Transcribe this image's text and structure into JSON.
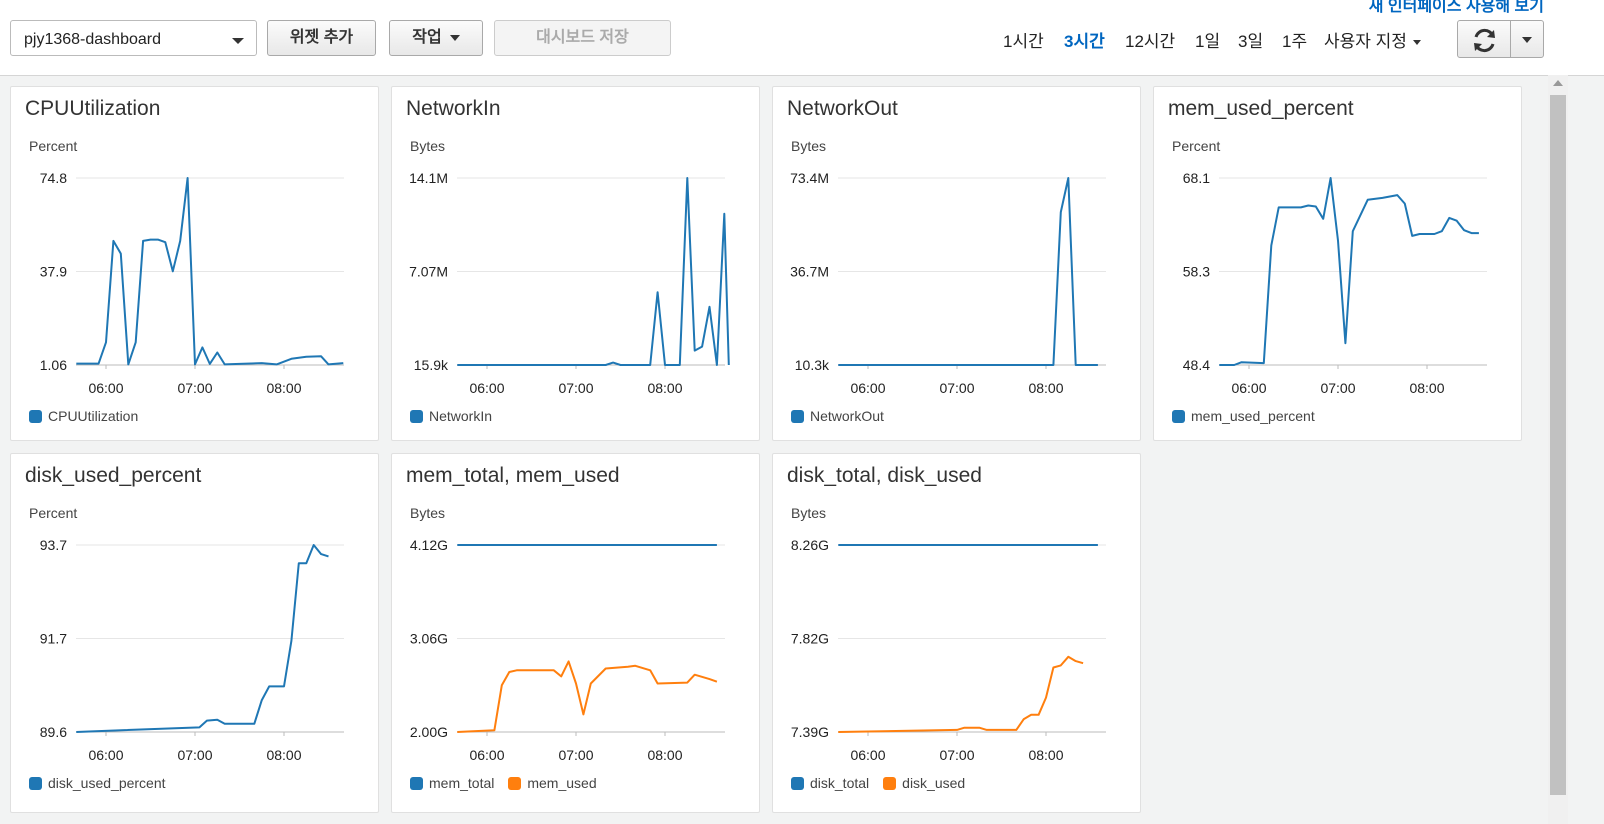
{
  "toolbar": {
    "dashboard_select": "pjy1368-dashboard",
    "add_widget": "위젯 추가",
    "actions": "작업",
    "save_dashboard": "대시보드 저장",
    "top_link": "새 인터페이스 사용해 보기",
    "time_ranges": [
      {
        "label": "1시간",
        "active": false
      },
      {
        "label": "3시간",
        "active": true
      },
      {
        "label": "12시간",
        "active": false
      },
      {
        "label": "1일",
        "active": false
      },
      {
        "label": "3일",
        "active": false
      },
      {
        "label": "1주",
        "active": false
      }
    ],
    "custom_range": "사용자 지정",
    "refresh_icon": "refresh-icon"
  },
  "colors": {
    "series1": "#1f77b4",
    "series2": "#ff7f0e",
    "accent": "#0066c0"
  },
  "chart_data": [
    {
      "type": "line",
      "title": "CPUUtilization",
      "ylabel": "Percent",
      "yticks": [
        "74.8",
        "37.9",
        "1.06"
      ],
      "ylim": [
        1.06,
        74.8
      ],
      "xticks": [
        "06:00",
        "07:00",
        "08:00"
      ],
      "series": [
        {
          "name": "CPUUtilization",
          "color": "#1f77b4",
          "points": [
            [
              -20,
              1.6
            ],
            [
              -5,
              1.6
            ],
            [
              0,
              10
            ],
            [
              5,
              50
            ],
            [
              10,
              45
            ],
            [
              15,
              1.3
            ],
            [
              20,
              10
            ],
            [
              25,
              50
            ],
            [
              30,
              50.5
            ],
            [
              35,
              50.5
            ],
            [
              40,
              49.5
            ],
            [
              45,
              38
            ],
            [
              50,
              50
            ],
            [
              55,
              74.8
            ],
            [
              60,
              1.3
            ],
            [
              65,
              8
            ],
            [
              70,
              1.5
            ],
            [
              75,
              6
            ],
            [
              80,
              1.3
            ],
            [
              90,
              1.5
            ],
            [
              105,
              1.8
            ],
            [
              115,
              1.3
            ],
            [
              125,
              3.5
            ],
            [
              135,
              4.3
            ],
            [
              145,
              4.5
            ],
            [
              150,
              1.3
            ],
            [
              160,
              1.8
            ]
          ]
        }
      ]
    },
    {
      "type": "line",
      "title": "NetworkIn",
      "ylabel": "Bytes",
      "yticks": [
        "14.1M",
        "7.07M",
        "15.9k"
      ],
      "ylim": [
        0.0159,
        14.1
      ],
      "yunit": "M",
      "xticks": [
        "06:00",
        "07:00",
        "08:00"
      ],
      "series": [
        {
          "name": "NetworkIn",
          "color": "#1f77b4",
          "points": [
            [
              -20,
              0.0159
            ],
            [
              80,
              0.0159
            ],
            [
              85,
              0.2
            ],
            [
              90,
              0.0159
            ],
            [
              95,
              0.0159
            ],
            [
              105,
              0.0159
            ],
            [
              110,
              0.0159
            ],
            [
              115,
              5.5
            ],
            [
              120,
              0.0159
            ],
            [
              130,
              0.0159
            ],
            [
              135,
              14.1
            ],
            [
              140,
              1.1
            ],
            [
              145,
              1.4
            ],
            [
              150,
              4.4
            ],
            [
              155,
              0.0159
            ],
            [
              160,
              11.4
            ],
            [
              163,
              0.0159
            ]
          ]
        }
      ]
    },
    {
      "type": "line",
      "title": "NetworkOut",
      "ylabel": "Bytes",
      "yticks": [
        "73.4M",
        "36.7M",
        "10.3k"
      ],
      "ylim": [
        0.0103,
        73.4
      ],
      "yunit": "M",
      "xticks": [
        "06:00",
        "07:00",
        "08:00"
      ],
      "series": [
        {
          "name": "NetworkOut",
          "color": "#1f77b4",
          "points": [
            [
              -20,
              0.0103
            ],
            [
              125,
              0.0103
            ],
            [
              130,
              60
            ],
            [
              135,
              73.4
            ],
            [
              140,
              0.0103
            ],
            [
              155,
              0.0103
            ]
          ]
        }
      ]
    },
    {
      "type": "line",
      "title": "mem_used_percent",
      "ylabel": "Percent",
      "yticks": [
        "68.1",
        "58.3",
        "48.4"
      ],
      "ylim": [
        48.4,
        68.1
      ],
      "xticks": [
        "06:00",
        "07:00",
        "08:00"
      ],
      "series": [
        {
          "name": "mem_used_percent",
          "color": "#1f77b4",
          "points": [
            [
              -20,
              48.4
            ],
            [
              -10,
              48.4
            ],
            [
              -5,
              48.7
            ],
            [
              10,
              48.6
            ],
            [
              15,
              61
            ],
            [
              20,
              65
            ],
            [
              35,
              65
            ],
            [
              40,
              65.2
            ],
            [
              45,
              65.1
            ],
            [
              50,
              63.8
            ],
            [
              55,
              68.1
            ],
            [
              60,
              61.5
            ],
            [
              65,
              50.7
            ],
            [
              70,
              62.5
            ],
            [
              80,
              65.8
            ],
            [
              90,
              66
            ],
            [
              100,
              66.3
            ],
            [
              105,
              65.4
            ],
            [
              110,
              62
            ],
            [
              115,
              62.2
            ],
            [
              125,
              62.2
            ],
            [
              130,
              62.5
            ],
            [
              135,
              63.9
            ],
            [
              140,
              63.6
            ],
            [
              145,
              62.6
            ],
            [
              150,
              62.3
            ],
            [
              155,
              62.3
            ]
          ]
        }
      ]
    },
    {
      "type": "line",
      "title": "disk_used_percent",
      "ylabel": "Percent",
      "yticks": [
        "93.7",
        "91.7",
        "89.6"
      ],
      "ylim": [
        89.6,
        93.7
      ],
      "xticks": [
        "06:00",
        "07:00",
        "08:00"
      ],
      "series": [
        {
          "name": "disk_used_percent",
          "color": "#1f77b4",
          "points": [
            [
              -20,
              89.6
            ],
            [
              -5,
              89.62
            ],
            [
              63,
              89.7
            ],
            [
              68,
              89.85
            ],
            [
              75,
              89.87
            ],
            [
              80,
              89.78
            ],
            [
              100,
              89.78
            ],
            [
              105,
              90.3
            ],
            [
              110,
              90.6
            ],
            [
              120,
              90.6
            ],
            [
              125,
              91.6
            ],
            [
              130,
              93.3
            ],
            [
              135,
              93.3
            ],
            [
              140,
              93.7
            ],
            [
              145,
              93.5
            ],
            [
              150,
              93.45
            ]
          ]
        }
      ]
    },
    {
      "type": "line",
      "title": "mem_total, mem_used",
      "ylabel": "Bytes",
      "yticks": [
        "4.12G",
        "3.06G",
        "2.00G"
      ],
      "ylim": [
        2.0,
        4.12
      ],
      "yunit": "G",
      "xticks": [
        "06:00",
        "07:00",
        "08:00"
      ],
      "series": [
        {
          "name": "mem_total",
          "color": "#1f77b4",
          "points": [
            [
              -20,
              4.12
            ],
            [
              155,
              4.12
            ]
          ]
        },
        {
          "name": "mem_used",
          "color": "#ff7f0e",
          "points": [
            [
              -20,
              2.0
            ],
            [
              5,
              2.02
            ],
            [
              10,
              2.53
            ],
            [
              15,
              2.68
            ],
            [
              20,
              2.7
            ],
            [
              45,
              2.7
            ],
            [
              50,
              2.63
            ],
            [
              55,
              2.8
            ],
            [
              60,
              2.55
            ],
            [
              65,
              2.2
            ],
            [
              70,
              2.55
            ],
            [
              80,
              2.72
            ],
            [
              95,
              2.74
            ],
            [
              100,
              2.75
            ],
            [
              110,
              2.7
            ],
            [
              115,
              2.55
            ],
            [
              135,
              2.56
            ],
            [
              140,
              2.65
            ],
            [
              150,
              2.6
            ],
            [
              155,
              2.57
            ]
          ]
        }
      ]
    },
    {
      "type": "line",
      "title": "disk_total, disk_used",
      "ylabel": "Bytes",
      "yticks": [
        "8.26G",
        "7.82G",
        "7.39G"
      ],
      "ylim": [
        7.39,
        8.26
      ],
      "yunit": "G",
      "xticks": [
        "06:00",
        "07:00",
        "08:00"
      ],
      "series": [
        {
          "name": "disk_total",
          "color": "#1f77b4",
          "points": [
            [
              -20,
              8.26
            ],
            [
              155,
              8.26
            ]
          ]
        },
        {
          "name": "disk_used",
          "color": "#ff7f0e",
          "points": [
            [
              -20,
              7.39
            ],
            [
              60,
              7.4
            ],
            [
              65,
              7.41
            ],
            [
              75,
              7.41
            ],
            [
              80,
              7.4
            ],
            [
              100,
              7.4
            ],
            [
              105,
              7.45
            ],
            [
              110,
              7.47
            ],
            [
              115,
              7.47
            ],
            [
              120,
              7.55
            ],
            [
              125,
              7.69
            ],
            [
              130,
              7.7
            ],
            [
              135,
              7.74
            ],
            [
              140,
              7.72
            ],
            [
              145,
              7.71
            ]
          ]
        }
      ]
    }
  ]
}
